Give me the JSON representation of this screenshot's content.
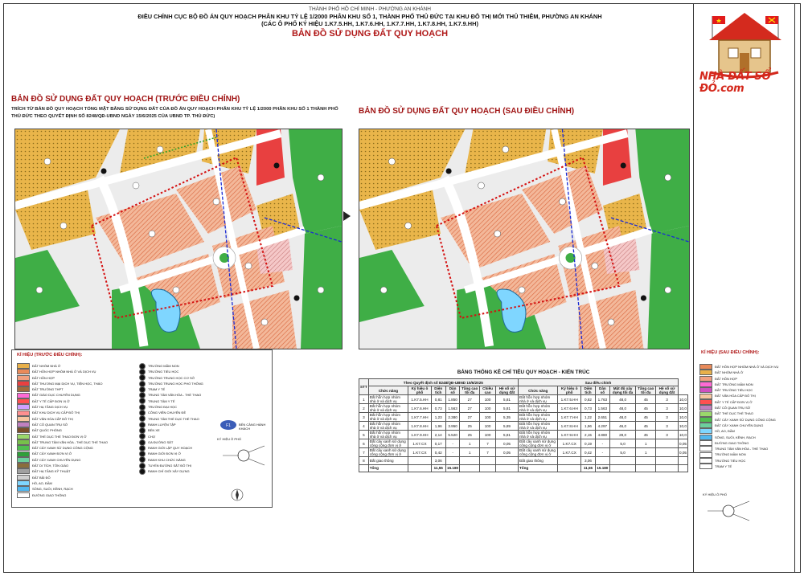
{
  "header": {
    "line1": "THÀNH PHỐ HỒ CHÍ MINH - PHƯỜNG AN KHÁNH",
    "line2": "ĐIỀU CHỈNH CỤC BỘ ĐỒ ÁN QUY HOẠCH PHÂN KHU TỶ LỆ 1/2000 PHÂN KHU SỐ 1, THÀNH PHỐ THỦ ĐỨC TẠI KHU ĐÔ THỊ MỚI THỦ THIÊM, PHƯỜNG AN KHÁNH",
    "line3": "(CÁC Ô PHỐ KÝ HIỆU 1.K7.5.HH, 1.K7.6.HH, 1.K7.7.HH, 1.K7.8.HH, 1.K7.9.HH)",
    "title": "BẢN ĐỒ SỬ DỤNG ĐẤT QUY HOẠCH"
  },
  "logo": {
    "text": "NHÀ ĐẤT SỔ ĐỎ.com"
  },
  "left": {
    "title": "BẢN ĐỒ SỬ DỤNG ĐẤT QUY HOẠCH (TRƯỚC ĐIỀU CHỈNH)",
    "subtitle_1": "TRÍCH TỪ BẢN ĐỒ QUY HOẠCH TỔNG MẶT BẰNG SỬ DỤNG ĐẤT CỦA ĐỒ ÁN QUY HOẠCH PHÂN KHU TỶ LỆ 1/2000 PHÂN KHU SỐ 1 THÀNH PHỐ",
    "subtitle_2": "THỦ ĐỨC THEO QUYẾT ĐỊNH SỐ 8248/QĐ-UBND NGÀY 15/6/2025 CỦA UBND TP. THỦ ĐỨC)"
  },
  "right": {
    "title": "BẢN ĐỒ SỬ DỤNG ĐẤT QUY HOẠCH (SAU ĐIỀU CHỈNH)"
  },
  "legend_left": {
    "title": "KÍ HIỆU (TRƯỚC ĐIỀU CHỈNH):",
    "col_a": [
      {
        "label": "ĐẤT NHÓM NHÀ Ở",
        "color": "#e8b04a"
      },
      {
        "label": "ĐẤT HỖN HỢP NHÓM NHÀ Ở VÀ DỊCH VỤ",
        "color": "#e98a5a"
      },
      {
        "label": "ĐẤT HỖN HỢP",
        "color": "#f0a080"
      },
      {
        "label": "ĐẤT THƯƠNG MẠI DỊCH VỤ, TIỆN HỌC, THÁO",
        "color": "#e84040"
      },
      {
        "label": "ĐẤT TRƯỜNG THPT",
        "color": "#a06b3b"
      },
      {
        "label": "ĐẤT GIÁO DỤC CHUYÊN DỤNG",
        "color": "#ff6ad5"
      },
      {
        "label": "ĐẤT Y TẾ CẤP ĐƠN VỊ Ở",
        "color": "#ff5050"
      },
      {
        "label": "ĐẤT HẠ TẦNG DỊCH VỤ",
        "color": "#d0a0ff"
      },
      {
        "label": "ĐẤT KHU DỊCH VỤ CẤP ĐÔ THỊ",
        "color": "#ff9090"
      },
      {
        "label": "ĐẤT VĂN HÓA CẤP ĐÔ THỊ",
        "color": "#f7c6a0"
      },
      {
        "label": "ĐẤT CÔ QUAN TRỤ SỞ",
        "color": "#c080c0"
      },
      {
        "label": "ĐẤT QUỐC PHÒNG",
        "color": "#7c4e2a"
      },
      {
        "label": "ĐẤT THỂ DỤC THỂ THAO ĐƠN VỊ Ở",
        "color": "#9ad86b"
      },
      {
        "label": "ĐẤT TRUNG TÂM VĂN HÓA - THỂ DỤC THỂ THAO",
        "color": "#77c04a"
      },
      {
        "label": "ĐẤT CÂY XANH SỬ DỤNG CÔNG CỘNG",
        "color": "#4fbf4f"
      },
      {
        "label": "ĐẤT CÂY XANH ĐƠN VỊ Ở",
        "color": "#2f9f3a"
      },
      {
        "label": "ĐẤT CÂY XANH CHUYÊN DỤNG",
        "color": "#6ccf9e"
      },
      {
        "label": "ĐẤT DI TÍCH, TÔN GIÁO",
        "color": "#8a6d3b"
      },
      {
        "label": "ĐẤT HẠ TẦNG KỸ THUẬT",
        "color": "#a0a0a0"
      },
      {
        "label": "ĐẤT BÃI ĐỖ",
        "color": "#cfcfcf"
      },
      {
        "label": "HỒ, AO, ĐẦM",
        "color": "#7fd6ff"
      },
      {
        "label": "SÔNG, SUỐI, KÊNH, RẠCH",
        "color": "#52b8f0"
      },
      {
        "label": "ĐƯỜNG GIAO THÔNG",
        "color": "#ffffff"
      }
    ],
    "col_b": [
      {
        "label": "TRƯỜNG MẦM NON"
      },
      {
        "label": "TRƯỜNG TIỂU HỌC"
      },
      {
        "label": "TRƯỜNG TRUNG HỌC CƠ SỞ"
      },
      {
        "label": "TRƯỜNG TRUNG HỌC PHỔ THÔNG"
      },
      {
        "label": "TRẠM Y TẾ"
      },
      {
        "label": "TRUNG TÂM VĂN HÓA - THỂ THAO"
      },
      {
        "label": "TRUNG TÂM Y TẾ"
      },
      {
        "label": "TRƯỜNG ĐẠI HỌC"
      },
      {
        "label": "CÔNG VIÊN CHUYÊN ĐỀ"
      },
      {
        "label": "TRUNG TÂM THỂ DỤC THỂ THAO"
      },
      {
        "label": "RANH LUYỆN TẬP"
      },
      {
        "label": "BẾN XE"
      },
      {
        "label": "CHỢ"
      },
      {
        "label": "GA ĐƯỜNG SẮT"
      },
      {
        "label": "RANH GIỚI LẬP QUY HOẠCH"
      },
      {
        "label": "RANH GIỚI ĐƠN VỊ Ở"
      },
      {
        "label": "RANH KHU CHỨC NĂNG"
      },
      {
        "label": "TUYẾN ĐƯỜNG SẮT ĐÔ THỊ"
      },
      {
        "label": "RANH CHỈ GIỚI XÂY DỰNG"
      }
    ],
    "bridge_label": "BẾN CẢNG HÀNH KHÁCH",
    "north_label": "KÝ HIỆU Ô PHỐ"
  },
  "legend_right": {
    "title": "KÍ HIỆU (SAU ĐIỀU CHỈNH):",
    "items": [
      {
        "label": "ĐẤT HỖN HỢP NHÓM NHÀ Ở VÀ DỊCH VỤ",
        "color": "#e98a5a"
      },
      {
        "label": "ĐẤT NHÓM NHÀ Ở",
        "color": "#e8b04a"
      },
      {
        "label": "ĐẤT HỖN HỢP",
        "color": "#f0a080"
      },
      {
        "label": "ĐẤT TRƯỜNG MẦM NON",
        "color": "#ff6ad5"
      },
      {
        "label": "ĐẤT TRƯỜNG TIỂU HỌC",
        "color": "#d050c0"
      },
      {
        "label": "ĐẤT VĂN HÓA CẤP ĐÔ THỊ",
        "color": "#f7c6a0"
      },
      {
        "label": "ĐẤT Y TẾ CẤP ĐƠN VỊ Ở",
        "color": "#ff5050"
      },
      {
        "label": "ĐẤT CÔ QUAN TRỤ SỞ",
        "color": "#c080c0"
      },
      {
        "label": "ĐẤT THỂ DỤC THỂ THAO",
        "color": "#9ad86b"
      },
      {
        "label": "ĐẤT CÂY XANH SỬ DỤNG CÔNG CỘNG",
        "color": "#4fbf4f"
      },
      {
        "label": "ĐẤT CÂY XANH CHUYÊN DỤNG",
        "color": "#6ccf9e"
      },
      {
        "label": "HỒ, AO, ĐẦM",
        "color": "#7fd6ff"
      },
      {
        "label": "SÔNG, SUỐI, KÊNH, RẠCH",
        "color": "#52b8f0"
      },
      {
        "label": "ĐƯỜNG GIAO THÔNG",
        "color": "#ffffff"
      },
      {
        "label": "TRUNG TÂM VĂN HÓA - THỂ THAO",
        "color": "#ffffff"
      },
      {
        "label": "TRƯỜNG MẦM NON",
        "color": "#ffffff"
      },
      {
        "label": "TRƯỜNG TIỂU HỌC",
        "color": "#ffffff"
      },
      {
        "label": "TRẠM Y TẾ",
        "color": "#ffffff"
      }
    ],
    "north_label": "KÝ HIỆU Ô PHỐ"
  },
  "table": {
    "title": "BẢNG THỐNG KÊ CHỈ TIÊU QUY HOẠCH - KIẾN TRÚC",
    "group_before": "Theo Quyết định số 8248/QĐ-UBND 15/6/2025",
    "group_after": "Sau điều chỉnh",
    "headers": [
      "STT",
      "Chức năng",
      "Ký hiệu ô phố",
      "Diện tích",
      "Dân số",
      "Tầng cao tối đa",
      "Chiều cao",
      "Hệ số sử dụng đất",
      "Chức năng",
      "Ký hiệu ô phố",
      "Diện tích",
      "Dân số",
      "Mật độ xây dựng tối đa",
      "Tầng cao tối đa",
      "Hệ số sử dụng đất"
    ],
    "rows": [
      [
        "1",
        "Đất hỗn hợp nhóm nhà ở và dịch vụ",
        "1.K7.5.HH",
        "0,81",
        "1.850",
        "27",
        "100",
        "5,81",
        "Đất hỗn hợp nhóm nhà ở và dịch vụ",
        "1.K7.5.HH",
        "0,82",
        "1.763",
        "48,0",
        "45",
        "3",
        "10,0"
      ],
      [
        "2",
        "Đất hỗn hợp nhóm nhà ở và dịch vụ",
        "1.K7.6.HH",
        "0,73",
        "1.563",
        "27",
        "100",
        "5,81",
        "Đất hỗn hợp nhóm nhà ở và dịch vụ",
        "1.K7.6.HH",
        "0,73",
        "1.563",
        "48,0",
        "45",
        "3",
        "10,0"
      ],
      [
        "3",
        "Đất hỗn hợp nhóm nhà ở và dịch vụ",
        "1.K7.7.HH",
        "1,23",
        "2.380",
        "27",
        "100",
        "5,35",
        "Đất hỗn hợp nhóm nhà ở và dịch vụ",
        "1.K7.7.HH",
        "1,22",
        "2.651",
        "48,0",
        "45",
        "3",
        "10,0"
      ],
      [
        "4",
        "Đất hỗn hợp nhóm nhà ở và dịch vụ",
        "1.K7.8.HH",
        "1,96",
        "3.950",
        "25",
        "100",
        "5,89",
        "Đất hỗn hợp nhóm nhà ở và dịch vụ",
        "1.K7.8.HH",
        "1,96",
        "4.297",
        "46,0",
        "45",
        "3",
        "10,0"
      ],
      [
        "5",
        "Đất hỗn hợp nhóm nhà ở và dịch vụ",
        "1.K7.9.HH",
        "2,14",
        "5.520",
        "25",
        "100",
        "5,81",
        "Đất hỗn hợp nhóm nhà ở và dịch vụ",
        "1.K7.9.HH",
        "2,15",
        "4.880",
        "28,0",
        "45",
        "3",
        "10,0"
      ],
      [
        "6",
        "Đất cây xanh sử dụng công cộng đơn vị ở",
        "1.K7.CX",
        "0,17",
        "-",
        "1",
        "7",
        "0,05",
        "Đất cây xanh sử dụng công cộng đơn vị ở",
        "1.K7.CX",
        "0,19",
        "-",
        "5,0",
        "1",
        "",
        "0,05"
      ],
      [
        "7",
        "Đất cây xanh sử dụng công cộng đơn vị ở",
        "1.K7.CX",
        "0,42",
        "-",
        "1",
        "7",
        "0,05",
        "Đất cây xanh sử dụng công cộng đơn vị ở",
        "1.K7.CX",
        "0,42",
        "-",
        "5,0",
        "1",
        "",
        "0,05"
      ],
      [
        "8",
        "Đất giao thông",
        "",
        "3,06",
        "",
        "",
        "",
        "",
        "Đất giao thông",
        "",
        "3,06",
        "",
        "",
        "",
        "",
        ""
      ]
    ],
    "total": [
      "",
      "Tổng",
      "",
      "11,55",
      "15.180",
      "",
      "",
      "",
      "Tổng",
      "",
      "11,55",
      "15.180",
      "",
      "",
      "",
      ""
    ]
  },
  "colors": {
    "title_red": "#a01414",
    "housing": "#e8b04a",
    "mixed": "#e98a5a",
    "green": "#4fbf4f",
    "water": "#7fd6ff",
    "road": "#ffffff"
  }
}
